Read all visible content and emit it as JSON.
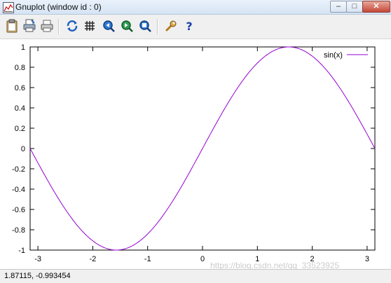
{
  "window": {
    "title": "Gnuplot (window id : 0)",
    "minimize_glyph": "–",
    "maximize_glyph": "□",
    "close_glyph": "✕"
  },
  "toolbar": {
    "items": [
      {
        "name": "clipboard-copy-button",
        "icon": "clipboard-icon"
      },
      {
        "name": "print-button",
        "icon": "print-icon"
      },
      {
        "name": "print-setup-button",
        "icon": "printer-icon"
      },
      {
        "name": "replot-button",
        "icon": "refresh-icon"
      },
      {
        "name": "grid-button",
        "icon": "grid-icon"
      },
      {
        "name": "zoom-previous-button",
        "icon": "zoom-previous-icon"
      },
      {
        "name": "zoom-next-button",
        "icon": "zoom-next-icon"
      },
      {
        "name": "unzoom-button",
        "icon": "unzoom-icon"
      },
      {
        "name": "options-button",
        "icon": "wrench-icon"
      },
      {
        "name": "help-button",
        "icon": "help-icon"
      }
    ],
    "help_glyph": "?"
  },
  "chart_data": {
    "type": "line",
    "function": "sin(x)",
    "series": [
      {
        "name": "sin(x)",
        "color": "#9400d3"
      }
    ],
    "xlim": [
      -3.14159,
      3.14159
    ],
    "ylim": [
      -1,
      1
    ],
    "xticks": [
      -3,
      -2,
      -1,
      0,
      1,
      2,
      3
    ],
    "yticks": [
      1,
      0.8,
      0.6,
      0.4,
      0.2,
      0,
      -0.2,
      -0.4,
      -0.6,
      -0.8,
      -1
    ],
    "legend_position": "top-right",
    "grid": false
  },
  "status": {
    "coordinates": "1.87115, -0.993454"
  },
  "watermark": "https://blog.csdn.net/qq_33523925"
}
